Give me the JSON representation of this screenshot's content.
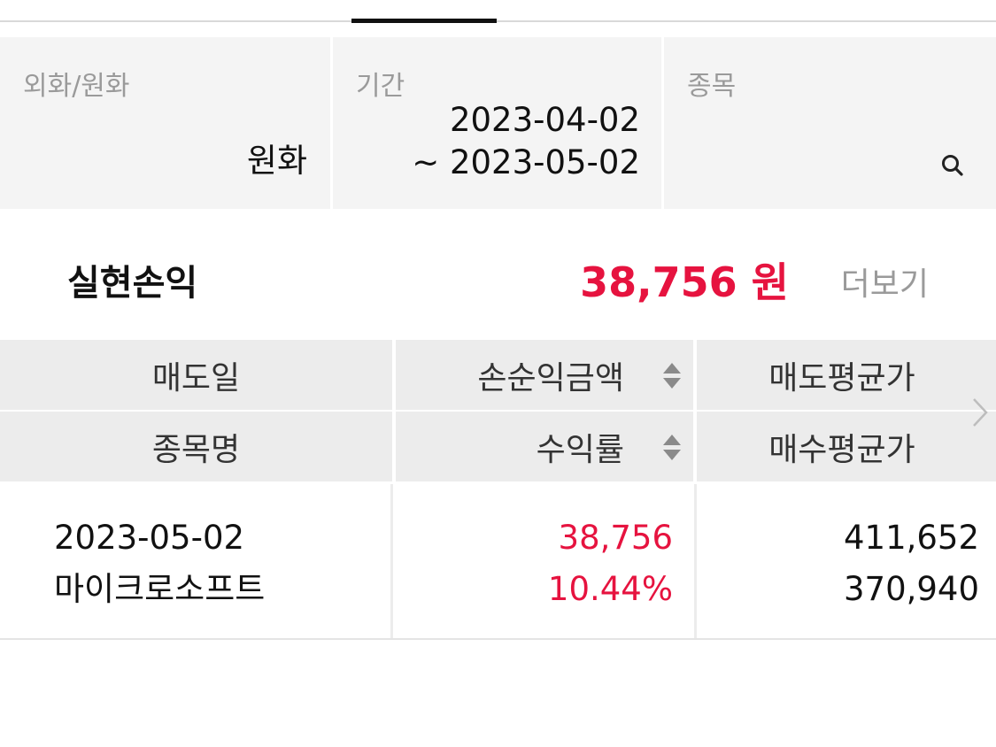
{
  "filters": {
    "currency": {
      "label": "외화/원화",
      "value": "원화"
    },
    "period": {
      "label": "기간",
      "start": "2023-04-02",
      "end": "~ 2023-05-02"
    },
    "stock": {
      "label": "종목",
      "value": ""
    }
  },
  "summary": {
    "label": "실현손익",
    "amount": "38,756 원",
    "more": "더보기"
  },
  "table": {
    "headers": {
      "sell_date": "매도일",
      "net_profit": "손순익금액",
      "avg_sell_price": "매도평균가",
      "stock_name": "종목명",
      "return_rate": "수익률",
      "avg_buy_price": "매수평균가"
    },
    "rows": [
      {
        "sell_date": "2023-05-02",
        "stock_name": "마이크로소프트",
        "net_profit": "38,756",
        "return_rate": "10.44%",
        "avg_sell_price": "411,652",
        "avg_buy_price": "370,940"
      }
    ]
  },
  "colors": {
    "accent": "#e6133f",
    "header_bg": "#ececec",
    "filter_bg": "#f4f4f4"
  },
  "icons": [
    "search-icon",
    "sort-icon",
    "chevron-right-icon"
  ]
}
